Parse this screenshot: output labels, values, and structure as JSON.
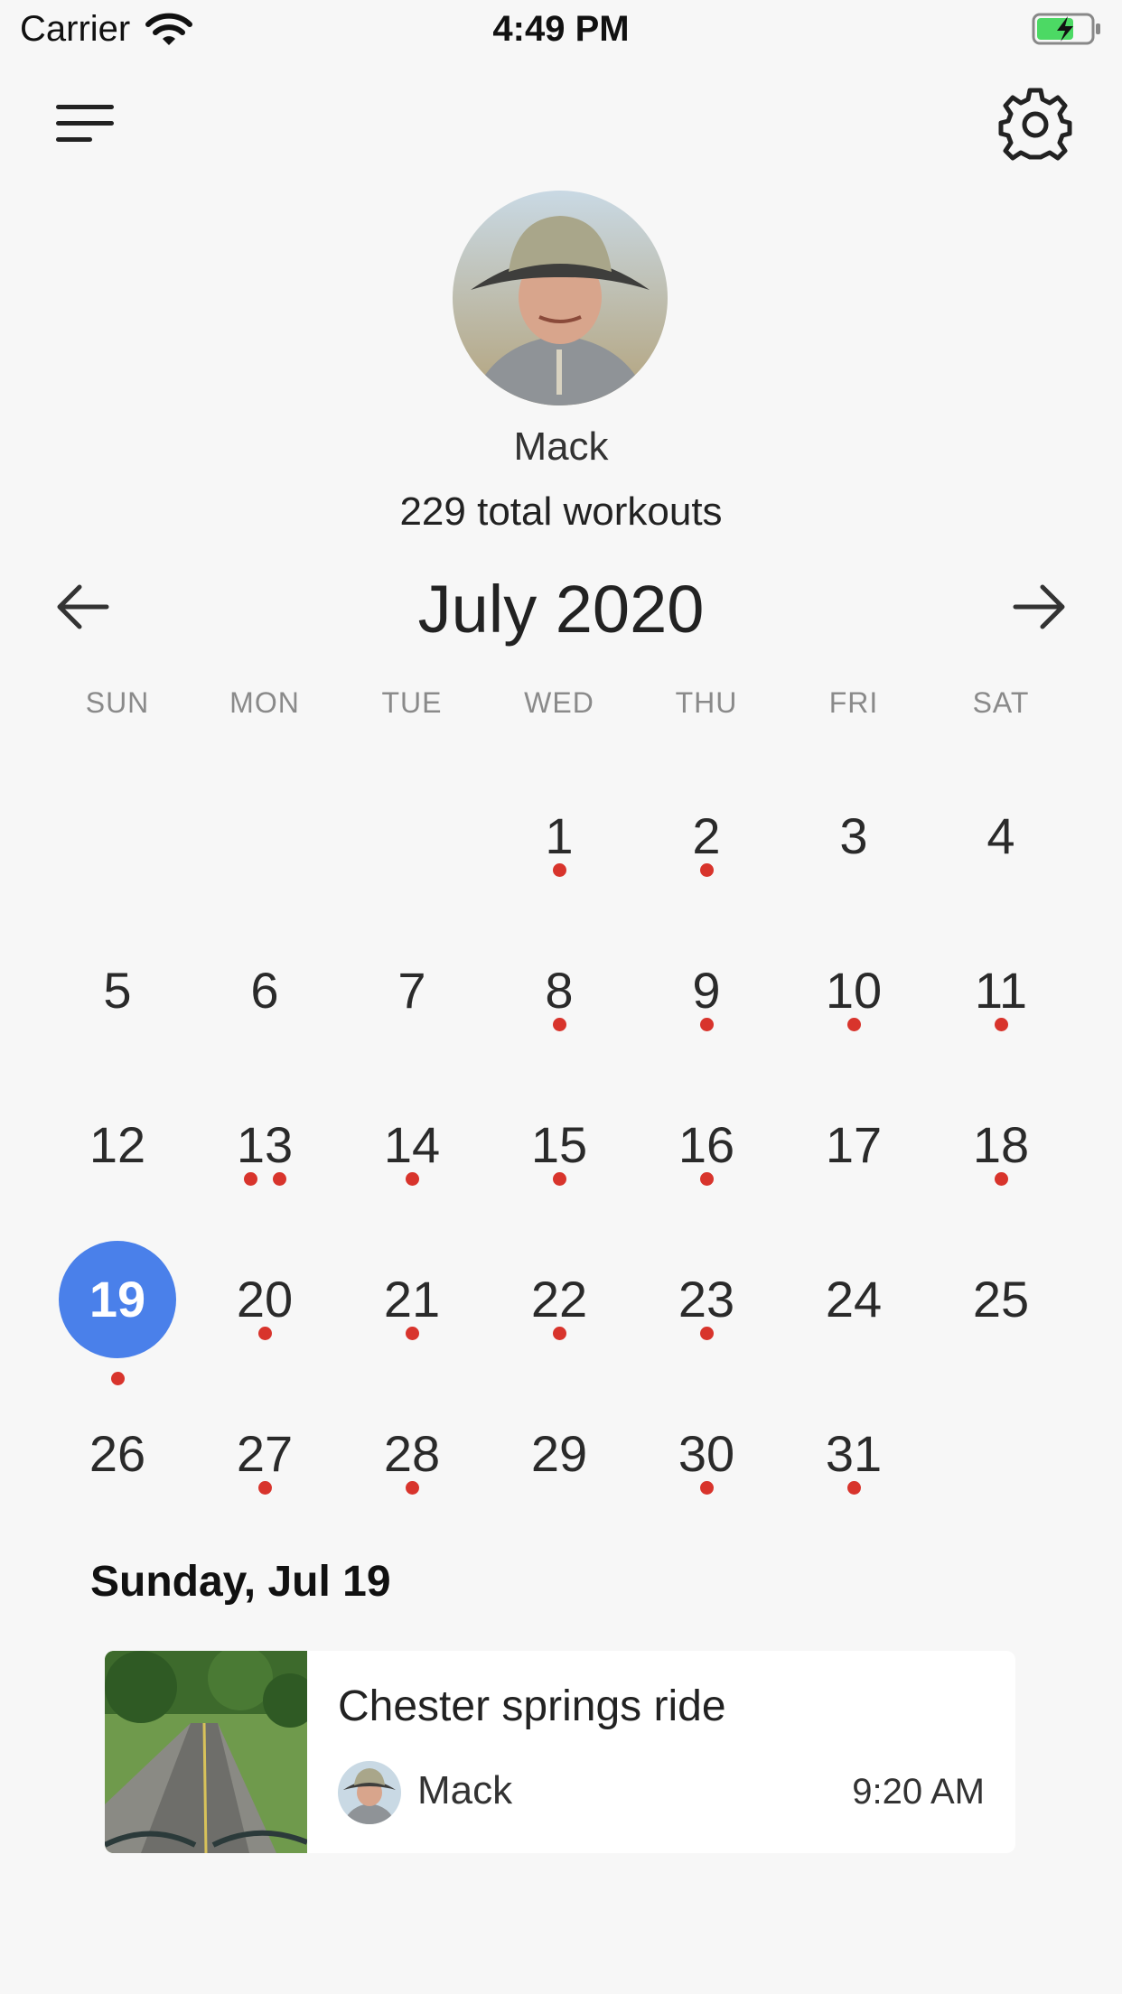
{
  "status_bar": {
    "carrier": "Carrier",
    "time": "4:49 PM"
  },
  "header": {
    "menu_icon": "hamburger-menu-icon",
    "settings_icon": "gear-icon"
  },
  "profile": {
    "name": "Mack",
    "total_workouts": "229 total workouts"
  },
  "calendar": {
    "month_title": "July 2020",
    "prev_icon": "arrow-left-icon",
    "next_icon": "arrow-right-icon",
    "weekdays": [
      "SUN",
      "MON",
      "TUE",
      "WED",
      "THU",
      "FRI",
      "SAT"
    ],
    "first_weekday_index": 3,
    "selected_day": 19,
    "days": [
      {
        "day": "1",
        "workouts": 1
      },
      {
        "day": "2",
        "workouts": 1
      },
      {
        "day": "3",
        "workouts": 0
      },
      {
        "day": "4",
        "workouts": 0
      },
      {
        "day": "5",
        "workouts": 0
      },
      {
        "day": "6",
        "workouts": 0
      },
      {
        "day": "7",
        "workouts": 0
      },
      {
        "day": "8",
        "workouts": 1
      },
      {
        "day": "9",
        "workouts": 1
      },
      {
        "day": "10",
        "workouts": 1
      },
      {
        "day": "11",
        "workouts": 1
      },
      {
        "day": "12",
        "workouts": 0
      },
      {
        "day": "13",
        "workouts": 2
      },
      {
        "day": "14",
        "workouts": 1
      },
      {
        "day": "15",
        "workouts": 1
      },
      {
        "day": "16",
        "workouts": 1
      },
      {
        "day": "17",
        "workouts": 0
      },
      {
        "day": "18",
        "workouts": 1
      },
      {
        "day": "19",
        "workouts": 1
      },
      {
        "day": "20",
        "workouts": 1
      },
      {
        "day": "21",
        "workouts": 1
      },
      {
        "day": "22",
        "workouts": 1
      },
      {
        "day": "23",
        "workouts": 1
      },
      {
        "day": "24",
        "workouts": 0
      },
      {
        "day": "25",
        "workouts": 0
      },
      {
        "day": "26",
        "workouts": 0
      },
      {
        "day": "27",
        "workouts": 1
      },
      {
        "day": "28",
        "workouts": 1
      },
      {
        "day": "29",
        "workouts": 0
      },
      {
        "day": "30",
        "workouts": 1
      },
      {
        "day": "31",
        "workouts": 1
      }
    ],
    "colors": {
      "selected": "#4a80ea",
      "workout_dot": "#d8342c"
    }
  },
  "selected_day": {
    "title": "Sunday, Jul 19",
    "workouts": [
      {
        "title": "Chester springs ride",
        "user": "Mack",
        "time": "9:20 AM"
      }
    ]
  }
}
